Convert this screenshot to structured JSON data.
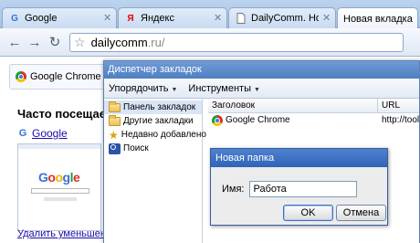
{
  "browser": {
    "tabs": [
      {
        "title": "Google",
        "favicon": "G",
        "favicon_color": "#3b6fd6"
      },
      {
        "title": "Яндекс",
        "favicon": "Я",
        "favicon_color": "#e30000"
      },
      {
        "title": "DailyComm. Новост…",
        "favicon": "page-icon",
        "favicon_color": "#6b6b6b"
      },
      {
        "title": "Новая вкладка",
        "favicon": "",
        "favicon_color": ""
      }
    ],
    "omnibox": {
      "domain": "dailycomm",
      "rest": ".ru/"
    },
    "icons": {
      "back": "back-arrow-icon",
      "forward": "forward-arrow-icon",
      "reload": "reload-icon",
      "star": "star-icon"
    }
  },
  "new_tab_page": {
    "header_label": "Google Chrome",
    "most_visited_heading": "Часто посещаемые",
    "thumb_link": "Google",
    "remove_link": "Удалить уменьшенные"
  },
  "bookmark_manager": {
    "title": "Диспетчер закладок",
    "menu": {
      "organize": "Упорядочить",
      "tools": "Инструменты"
    },
    "tree": [
      {
        "label": "Панель закладок",
        "icon": "folder-icon",
        "selected": true
      },
      {
        "label": "Другие закладки",
        "icon": "folder-icon",
        "selected": false
      },
      {
        "label": "Недавно добавлено",
        "icon": "star-icon",
        "selected": false
      },
      {
        "label": "Поиск",
        "icon": "search-icon",
        "selected": false
      }
    ],
    "columns": {
      "title": "Заголовок",
      "url": "URL"
    },
    "rows": [
      {
        "title": "Google Chrome",
        "url": "http://tools.g"
      }
    ]
  },
  "dialog": {
    "title": "Новая папка",
    "name_label": "Имя:",
    "name_value": "Работа",
    "ok_label": "OK",
    "cancel_label": "Отмена"
  },
  "colors": {
    "accent": "#4f7fc3",
    "link": "#1a0dab"
  }
}
